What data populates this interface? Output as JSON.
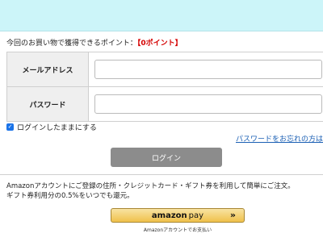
{
  "points": {
    "label": "今回のお買い物で獲得できるポイント：",
    "value": "【0ポイント】"
  },
  "form": {
    "email_label": "メールアドレス",
    "email_value": "",
    "password_label": "パスワード",
    "password_value": ""
  },
  "remember_me": {
    "label": "ログインしたままにする",
    "checked": true
  },
  "forgot_link": "パスワードをお忘れの方は",
  "login_button": "ログイン",
  "amazon": {
    "description_line1": "Amazonアカウントにご登録の住所・クレジットカード・ギフト券を利用して簡単にご注文。",
    "description_line2": "ギフト券利用分の0.5%をいつでも還元。",
    "button_logo": "amazon",
    "button_logo_pay": "pay",
    "button_arrow": "»",
    "button_sub": "Amazonアカウントでお支払い"
  },
  "colors": {
    "top_band": "#ccf5f9",
    "points_accent": "#d40000",
    "login_button_bg": "#8c8c8c",
    "link": "#1a5fb4",
    "amazon_gold": "#f0c14b"
  }
}
